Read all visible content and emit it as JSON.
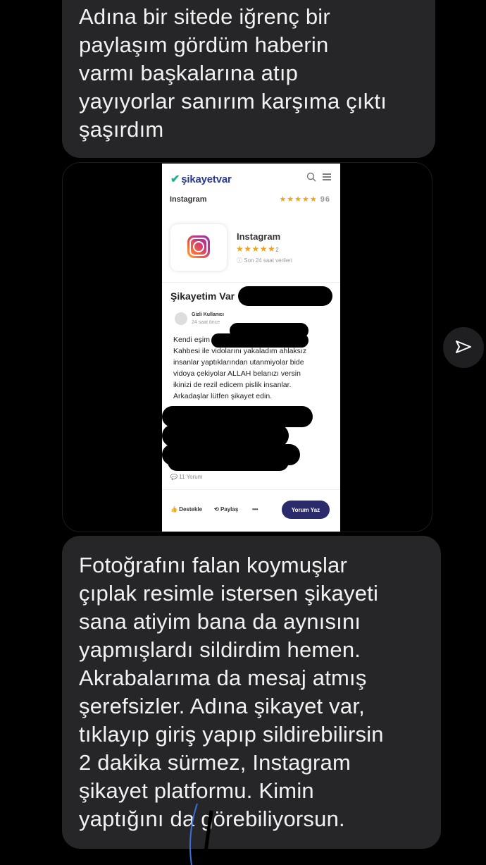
{
  "messages": {
    "first": "Adına bir sitede iğrenç bir\npaylaşım gördüm haberin\nvarmı başkalarına atıp\nyayıyorlar sanırım karşıma çıktı\nşaşırdım",
    "second": "Fotoğrafını falan koymuşlar\nçıplak resimle istersen şikayeti\nsana atiyim bana da aynısını\nyapmışlardı sildirdim hemen.\nAkrabalarıma da mesaj atmış\nşerefsizler. Adına şikayet var,\ntıklayıp giriş yapıp sildirebilirsin\n2 dakika sürmez, Instagram\nşikayet platformu. Kimin\nyaptığını da görebiliyorsun."
  },
  "screenshot": {
    "site_logo": "şikayetvar",
    "brand_label": "Instagram",
    "brand_stars": "★★★★★",
    "brand_score": "96",
    "card_title": "Instagram",
    "card_stars": "★★★★★",
    "card_rating_count": "2",
    "card_note": "Son 24 saat verileri",
    "complaint_title": "Şikayetim Var",
    "user_name": "Gizli Kullanıcı",
    "time": "24 saat önce",
    "body": "Kendi eşim ve\nKahbesi ile vidolarını yakaladım ahlaksız\ninsanlar yaptıklarından utanmiyolar bide\nvidoya çekiyolar ALLAH belanızı versin\nikinizi de rezil edicem pislik insanlar.\nArkadaşlar lütfen şikayet edin.",
    "comments": "11 Yorum",
    "support": "Destekle",
    "share": "Paylaş",
    "more": "•••",
    "write_comment": "Yorum Yaz"
  },
  "colors": {
    "bubble": "#262628",
    "brand_accent": "#2b3a8f",
    "star": "#f4a21c"
  }
}
